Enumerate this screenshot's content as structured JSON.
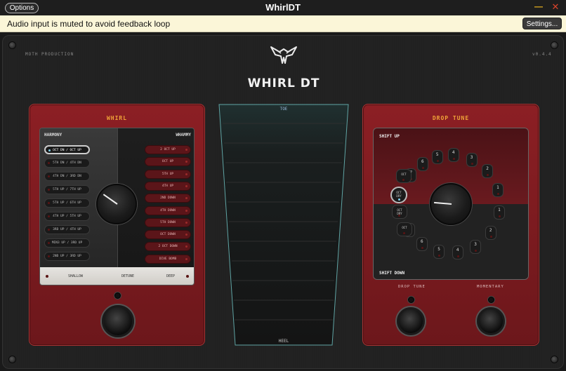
{
  "window": {
    "title": "WhirlDT",
    "options_label": "Options",
    "minimize_glyph": "—",
    "close_glyph": "✕"
  },
  "notice": {
    "text": "Audio input is muted to avoid feedback loop",
    "settings_label": "Settings..."
  },
  "plugin": {
    "company": "MOTH PRODUCTION",
    "version": "v0.4.4",
    "name": "WHIRL DT",
    "accent_color": "#f0a338",
    "panel_color": "#8c1f24"
  },
  "whirl": {
    "title": "WHIRL",
    "harmony_label": "HARMONY",
    "whammy_label": "WHAMMY",
    "harmony_items": [
      "OCT DN / OCT UP",
      "5TH DN / 4TH DN",
      "4TH DN / 3RD DN",
      "5TH UP / 7TH UP",
      "5TH UP / 6TH UP",
      "4TH UP / 5TH UP",
      "3RD UP / 4TH UP",
      "MIN3 UP / 3RD UP",
      "2ND UP / 3RD UP"
    ],
    "harmony_selected_index": 0,
    "whammy_items": [
      "2 OCT UP",
      "OCT UP",
      "5TH UP",
      "4TH UP",
      "2ND DOWN",
      "4TH DOWN",
      "5TH DOWN",
      "OCT DOWN",
      "2 OCT DOWN",
      "DIVE BOMB"
    ],
    "detune": {
      "left": "SHALLOW",
      "center": "DETUNE",
      "right": "DEEP"
    }
  },
  "pedal": {
    "toe": "TOE",
    "heel": "HEEL"
  },
  "drop_tune": {
    "title": "DROP TUNE",
    "shift_up": "SHIFT UP",
    "shift_down": "SHIFT DOWN",
    "oct_up": "OCT",
    "oct_dry_1": "OCT",
    "oct_dry_2": "DRY",
    "oct_down": "OCT",
    "up_semitones": [
      "7",
      "6",
      "5",
      "4",
      "3",
      "2",
      "1"
    ],
    "down_semitones": [
      "1",
      "2",
      "3",
      "4",
      "5",
      "6",
      "7"
    ],
    "footswitch_left": "DROP TUNE",
    "footswitch_right": "MOMENTARY"
  }
}
